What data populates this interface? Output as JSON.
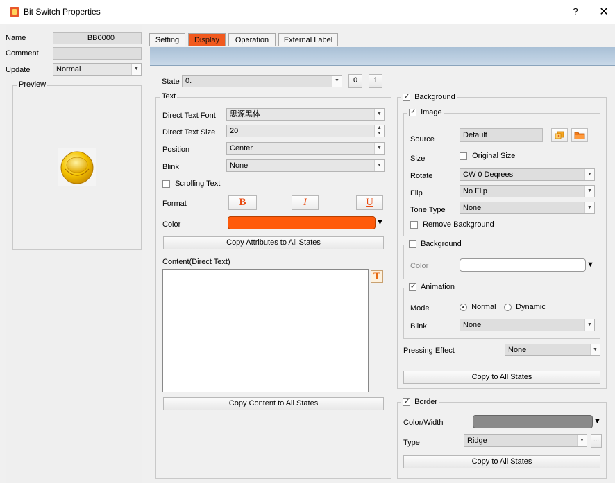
{
  "window": {
    "title": "Bit Switch Properties",
    "help_glyph": "?",
    "close_glyph": "✕",
    "icon": "app-icon"
  },
  "left": {
    "name_label": "Name",
    "name_value": "BB0000",
    "comment_label": "Comment",
    "comment_value": "",
    "update_label": "Update",
    "update_value": "Normal",
    "preview_label": "Preview",
    "preview_icon": "yellow-button-icon"
  },
  "tabs": [
    {
      "label": "Setting",
      "active": false
    },
    {
      "label": "Display",
      "active": true
    },
    {
      "label": "Operation",
      "active": false
    },
    {
      "label": "External Label",
      "active": false
    }
  ],
  "state": {
    "label": "State",
    "value": "0.",
    "btn0": "0",
    "btn1": "1"
  },
  "text_group": {
    "title": "Text",
    "font_label": "Direct Text Font",
    "font_value": "思源黑体",
    "size_label": "Direct Text Size",
    "size_value": "20",
    "position_label": "Position",
    "position_value": "Center",
    "blink_label": "Blink",
    "blink_value": "None",
    "scrolling_label": "Scrolling Text",
    "scrolling_checked": false,
    "format_label": "Format",
    "bold_glyph": "B",
    "italic_glyph": "I",
    "underline_glyph": "U",
    "color_label": "Color",
    "color_value": "#ff5a0a",
    "copy_attr_label": "Copy Attributes to All States",
    "content_label": "Content(Direct Text)",
    "content_value": "",
    "text_tool_glyph": "T",
    "copy_content_label": "Copy Content to All States"
  },
  "background": {
    "title": "Background",
    "checked": true,
    "image": {
      "title": "Image",
      "checked": true,
      "source_label": "Source",
      "source_value": "Default",
      "size_label": "Size",
      "original_size_label": "Original Size",
      "original_size_checked": false,
      "rotate_label": "Rotate",
      "rotate_value": "CW 0 Deqrees",
      "flip_label": "Flip",
      "flip_value": "No Flip",
      "tone_label": "Tone Type",
      "tone_value": "None",
      "remove_bg_label": "Remove Background",
      "remove_bg_checked": false
    },
    "bg_color": {
      "title": "Background",
      "checked": false,
      "color_label": "Color",
      "color_value": "#ffffff"
    },
    "animation": {
      "title": "Animation",
      "checked": true,
      "mode_label": "Mode",
      "mode_normal": "Normal",
      "mode_dynamic": "Dynamic",
      "mode_selected": "Normal",
      "blink_label": "Blink",
      "blink_value": "None"
    },
    "pressing_label": "Pressing Effect",
    "pressing_value": "None",
    "copy_label": "Copy to All States"
  },
  "border": {
    "title": "Border",
    "checked": true,
    "color_width_label": "Color/Width",
    "color_value": "#8a8a8a",
    "type_label": "Type",
    "type_value": "Ridge",
    "more_glyph": "...",
    "copy_label": "Copy to All States"
  }
}
